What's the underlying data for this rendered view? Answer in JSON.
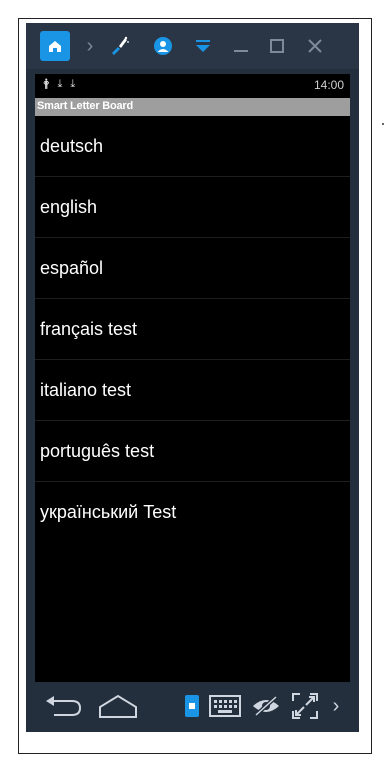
{
  "emulator": {
    "toolbar": {
      "chevron": "›",
      "more": "›"
    },
    "colors": {
      "accent": "#1a95e6",
      "chrome": "#2a3645",
      "appbar": "#9e9e9e"
    }
  },
  "statusbar": {
    "icons": [
      "🛉",
      "⤓",
      "⤓"
    ],
    "time": "14:00"
  },
  "app": {
    "title": "Smart Letter Board",
    "languages": [
      {
        "label": "deutsch"
      },
      {
        "label": "english"
      },
      {
        "label": "español"
      },
      {
        "label": "français test"
      },
      {
        "label": "italiano test"
      },
      {
        "label": "português test"
      },
      {
        "label": "український Test"
      }
    ]
  }
}
